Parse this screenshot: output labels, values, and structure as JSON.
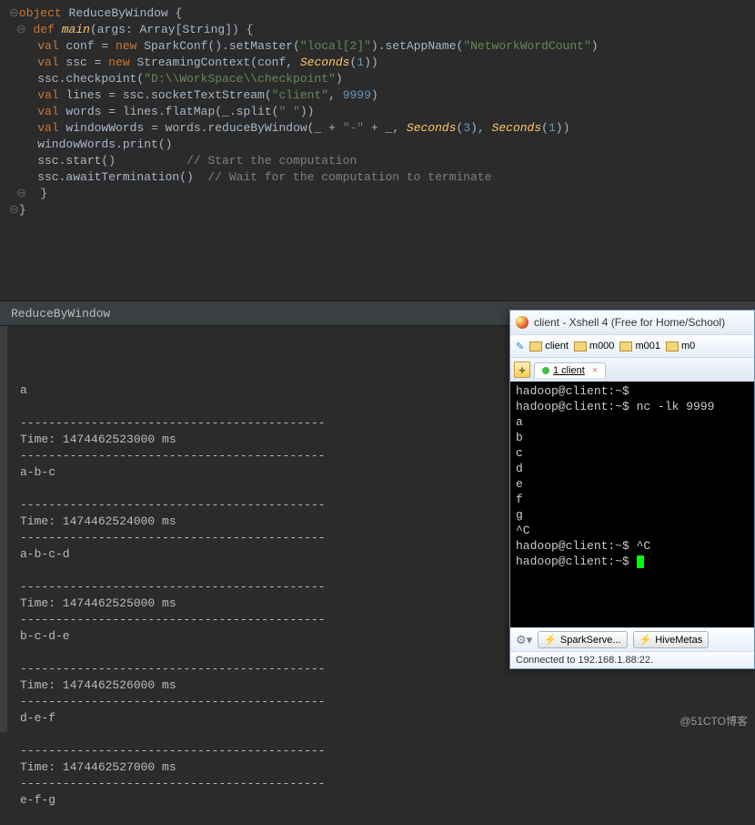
{
  "code": {
    "obj_kw": "object",
    "obj_name": " ReduceByWindow {",
    "def_kw": "def",
    "main_sig_a": "main",
    "main_sig_b": "(args: Array[",
    "main_sig_c": "String",
    "main_sig_d": "]) {",
    "l1a": "    ",
    "l1kw": "val",
    "l1b": " conf = ",
    "l1new": "new",
    "l1c": " SparkConf().setMaster(",
    "l1s1": "\"local[2]\"",
    "l1d": ").setAppName(",
    "l1s2": "\"NetworkWordCount\"",
    "l1e": ")",
    "l2a": "    ",
    "l2kw": "val",
    "l2b": " ssc = ",
    "l2new": "new",
    "l2c": " StreamingContext(conf, ",
    "l2fn": "Seconds",
    "l2d": "(",
    "l2n": "1",
    "l2e": "))",
    "l3a": "    ssc.checkpoint(",
    "l3s": "\"D:\\\\WorkSpace\\\\checkpoint\"",
    "l3b": ")",
    "l4": "",
    "l5a": "    ",
    "l5kw": "val",
    "l5b": " lines = ssc.socketTextStream(",
    "l5s1": "\"client\"",
    "l5c": ", ",
    "l5n": "9999",
    "l5d": ")",
    "l6": "",
    "l7a": "    ",
    "l7kw": "val",
    "l7b": " words = lines.flatMap(_.split(",
    "l7s": "\" \"",
    "l7c": "))",
    "l8a": "    ",
    "l8kw": "val",
    "l8b": " windowWords = words.reduceByWindow(_ + ",
    "l8s": "\"-\"",
    "l8c": " + _, ",
    "l8f1": "Seconds",
    "l8d": "(",
    "l8n1": "3",
    "l8e": "), ",
    "l8f2": "Seconds",
    "l8g": "(",
    "l8n2": "1",
    "l8h": "))",
    "l9": "",
    "l10": "    windowWords.print()",
    "l11": "",
    "l12a": "    ssc.start()          ",
    "l12c": "// Start the computation",
    "l13a": "    ssc.awaitTermination()  ",
    "l13c": "// Wait for the computation to terminate",
    "l14": "  }",
    "l15": "}"
  },
  "tab_name": "ReduceByWindow",
  "console_lines": [
    "",
    "a",
    "",
    "-------------------------------------------",
    "Time: 1474462523000 ms",
    "-------------------------------------------",
    "a-b-c",
    "",
    "-------------------------------------------",
    "Time: 1474462524000 ms",
    "-------------------------------------------",
    "a-b-c-d",
    "",
    "-------------------------------------------",
    "Time: 1474462525000 ms",
    "-------------------------------------------",
    "b-c-d-e",
    "",
    "-------------------------------------------",
    "Time: 1474462526000 ms",
    "-------------------------------------------",
    "d-e-f",
    "",
    "-------------------------------------------",
    "Time: 1474462527000 ms",
    "-------------------------------------------",
    "e-f-g"
  ],
  "xshell": {
    "title": "client - Xshell 4 (Free for Home/School)",
    "toolbar": [
      "client",
      "m000",
      "m001",
      "m0"
    ],
    "tab": "1 client",
    "term": "hadoop@client:~$\nhadoop@client:~$ nc -lk 9999\na\nb\nc\nd\ne\nf\ng\n^C\nhadoop@client:~$ ^C\nhadoop@client:~$ ",
    "buttons": [
      "SparkServe...",
      "HiveMetas"
    ],
    "status": "Connected to 192.168.1.88:22."
  },
  "watermark": "@51CTO博客"
}
